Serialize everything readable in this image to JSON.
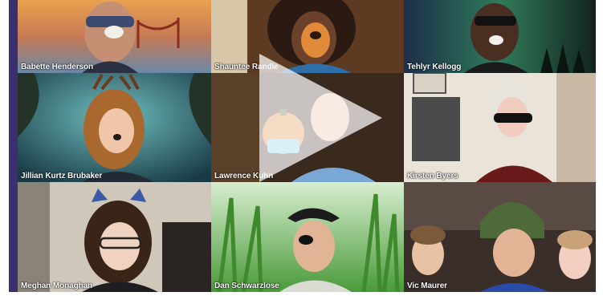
{
  "participants": [
    {
      "name": "Babette Henderson"
    },
    {
      "name": "Shauntee Randle"
    },
    {
      "name": "Tehlyr Kellogg"
    },
    {
      "name": "Jillian Kurtz Brubaker"
    },
    {
      "name": "Lawrence Kuhn"
    },
    {
      "name": "Kirsten Byers"
    },
    {
      "name": "Meghan Monaghan"
    },
    {
      "name": "Dan Schwarzlose"
    },
    {
      "name": "Vic Maurer"
    }
  ],
  "icons": {
    "play": "play-icon"
  },
  "colors": {
    "frame_border": "#3b2f6e",
    "label_text": "#ffffff"
  }
}
